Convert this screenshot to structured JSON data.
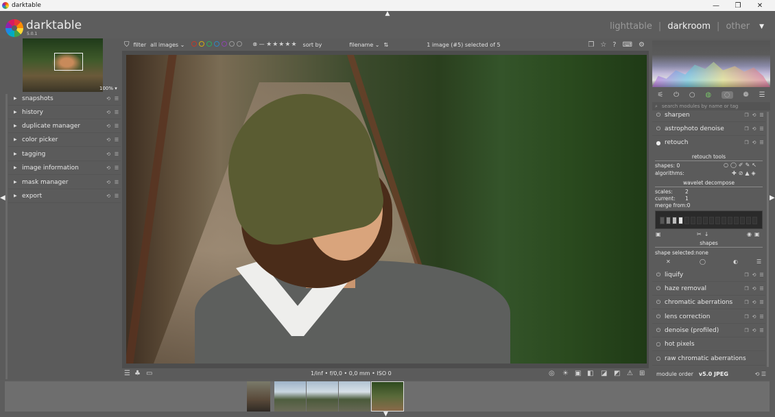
{
  "window": {
    "title": "darktable",
    "controls": [
      "—",
      "❐",
      "✕"
    ]
  },
  "header": {
    "app_name": "darktable",
    "version": "5.0.1",
    "views": [
      "lighttable",
      "darkroom",
      "other"
    ],
    "view_separator": "|",
    "active_view": "darkroom",
    "views_dropdown_glyph": "▼"
  },
  "navigator": {
    "zoom": "100%"
  },
  "left_modules": [
    {
      "label": "snapshots"
    },
    {
      "label": "history"
    },
    {
      "label": "duplicate manager"
    },
    {
      "label": "color picker"
    },
    {
      "label": "tagging"
    },
    {
      "label": "image information"
    },
    {
      "label": "mask manager"
    },
    {
      "label": "export"
    }
  ],
  "toolbar": {
    "filter_label": "filter",
    "filter_value": "all images",
    "sort_label": "sort by",
    "sort_value": "filename",
    "selection_info": "1 image (#5) selected of 5",
    "color_labels": [
      "#c0392b",
      "#d4ac0d",
      "#27ae60",
      "#2e86c1",
      "#8e44ad"
    ]
  },
  "info_bar": {
    "exif": "1/inf • f/0,0 • 0,0 mm • ISO 0"
  },
  "right_panel": {
    "search_placeholder": "search modules by name or tag",
    "modules_top": [
      {
        "label": "sharpen"
      },
      {
        "label": "astrophoto denoise"
      },
      {
        "label": "retouch"
      }
    ],
    "retouch": {
      "tools_title": "retouch tools",
      "shapes_label": "shapes: 0",
      "algorithms_label": "algorithms:",
      "wavelet_title": "wavelet decompose",
      "scales_label": "scales:",
      "scales_value": "2",
      "current_label": "current:",
      "current_value": "1",
      "merge_label": "merge from:0",
      "shapes_title": "shapes",
      "shape_selected": "shape selected:none"
    },
    "modules_bottom": [
      {
        "label": "liquify"
      },
      {
        "label": "haze removal"
      },
      {
        "label": "chromatic aberrations"
      },
      {
        "label": "lens correction"
      },
      {
        "label": "denoise (profiled)"
      },
      {
        "label": "hot pixels"
      },
      {
        "label": "raw chromatic aberrations"
      }
    ],
    "module_order_label": "module order",
    "module_order_value": "v5.0 JPEG"
  }
}
